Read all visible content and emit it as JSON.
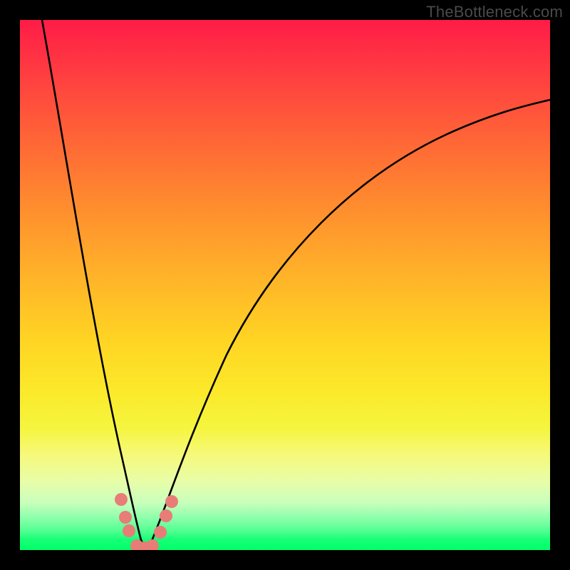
{
  "watermark": "TheBottleneck.com",
  "colors": {
    "frame": "#000000",
    "gradient_top": "#ff1c47",
    "gradient_bottom": "#00ff69",
    "curve": "#000000",
    "dots": "#e77d76"
  },
  "chart_data": {
    "type": "line",
    "title": "",
    "xlabel": "",
    "ylabel": "",
    "xlim": [
      0,
      100
    ],
    "ylim": [
      0,
      100
    ],
    "grid": false,
    "note": "Axes are unlabeled in the image; values are estimated percentages of the plot area from bottom-left origin.",
    "series": [
      {
        "name": "left-branch",
        "x": [
          4.2,
          6,
          8,
          10,
          12,
          14,
          16,
          18,
          19.5,
          21,
          22.3
        ],
        "y": [
          100,
          88,
          75,
          62,
          49,
          37,
          25,
          14,
          7,
          2,
          0
        ]
      },
      {
        "name": "right-branch",
        "x": [
          24.3,
          26,
          28,
          30,
          33,
          37,
          42,
          48,
          55,
          63,
          72,
          82,
          93,
          100
        ],
        "y": [
          0,
          3,
          7,
          12,
          19,
          27,
          36,
          45,
          53,
          61,
          68,
          75,
          81,
          85
        ]
      }
    ],
    "markers": [
      {
        "x": 19.1,
        "y": 9.5
      },
      {
        "x": 19.9,
        "y": 6.2
      },
      {
        "x": 20.6,
        "y": 3.6
      },
      {
        "x": 22.0,
        "y": 0.8
      },
      {
        "x": 23.5,
        "y": 0.4
      },
      {
        "x": 25.0,
        "y": 0.8
      },
      {
        "x": 26.5,
        "y": 3.4
      },
      {
        "x": 27.6,
        "y": 6.4
      },
      {
        "x": 28.6,
        "y": 9.1
      }
    ]
  }
}
